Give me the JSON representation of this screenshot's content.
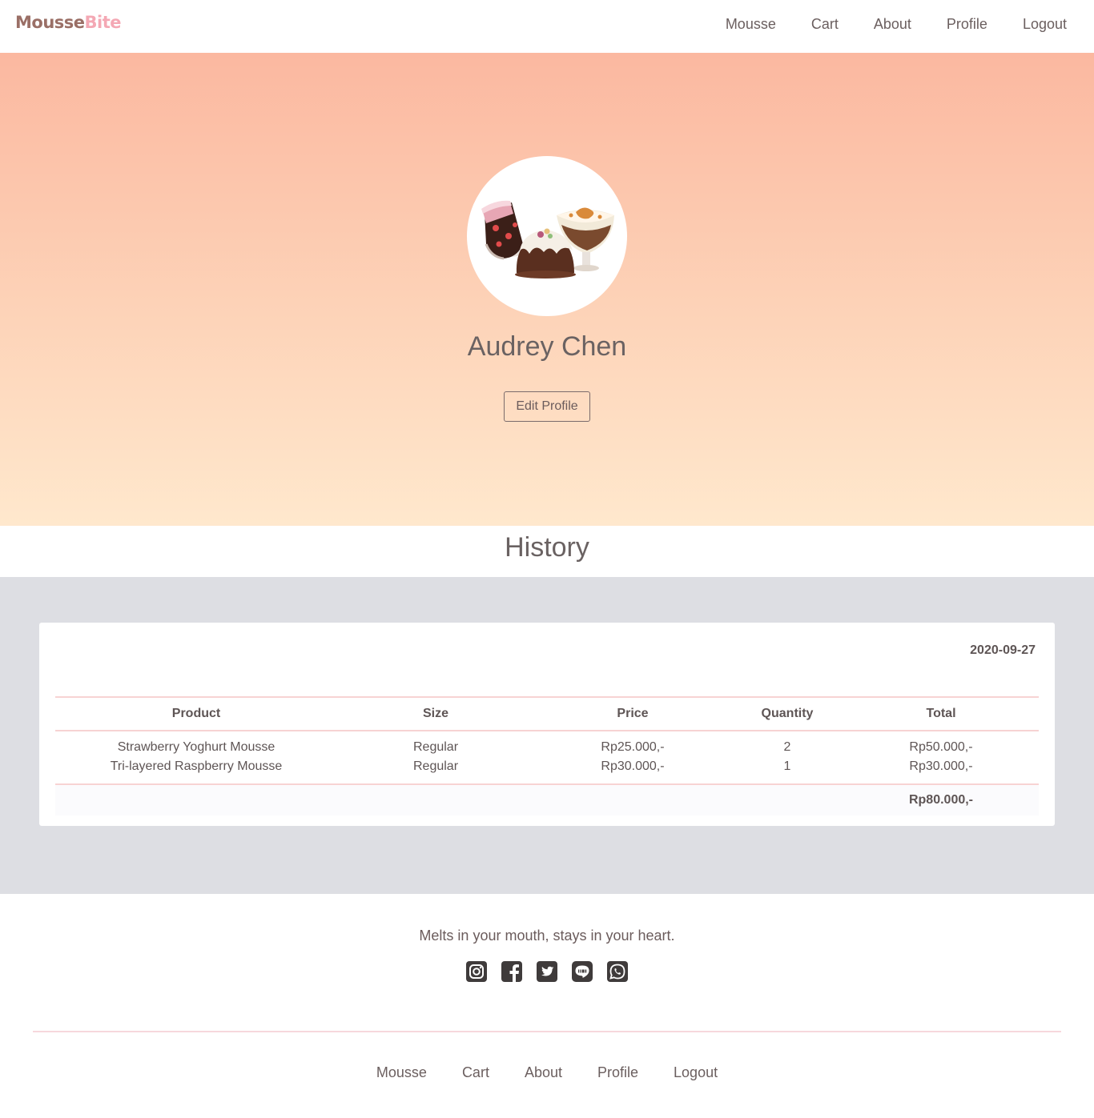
{
  "brand": {
    "part1": "Mousse",
    "part2": "Bite"
  },
  "nav": [
    "Mousse",
    "Cart",
    "About",
    "Profile",
    "Logout"
  ],
  "profile": {
    "name": "Audrey Chen",
    "edit_label": "Edit Profile"
  },
  "history": {
    "title": "History",
    "orders": [
      {
        "date": "2020-09-27",
        "columns": [
          "Product",
          "Size",
          "Price",
          "Quantity",
          "Total"
        ],
        "items": [
          [
            "Strawberry Yoghurt Mousse",
            "Regular",
            "Rp25.000,-",
            "2",
            "Rp50.000,-"
          ],
          [
            "Tri-layered Raspberry Mousse",
            "Regular",
            "Rp30.000,-",
            "1",
            "Rp30.000,-"
          ]
        ],
        "grand_total": "Rp80.000,-"
      }
    ]
  },
  "footer": {
    "tagline": "Melts in your mouth, stays in your heart.",
    "socials": [
      "instagram-icon",
      "facebook-icon",
      "twitter-icon",
      "line-icon",
      "whatsapp-icon"
    ],
    "nav": [
      "Mousse",
      "Cart",
      "About",
      "Profile",
      "Logout"
    ]
  },
  "colors": {
    "hero_top": "#fbb8a0",
    "hero_bottom": "#ffe8cd",
    "history_bg": "#dddee3",
    "divider": "#f7d3d3"
  }
}
